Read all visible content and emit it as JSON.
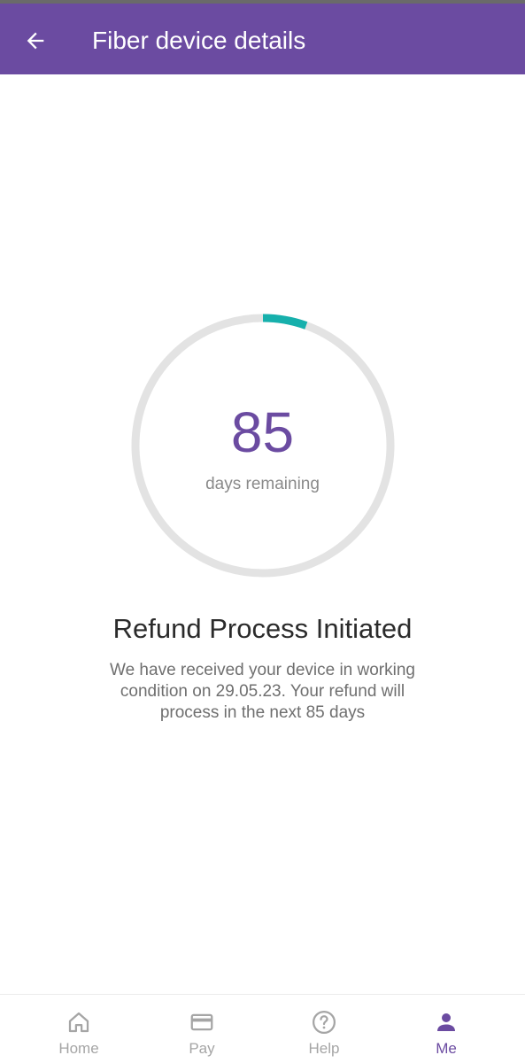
{
  "header": {
    "title": "Fiber device details",
    "back_icon": "arrow-left-icon"
  },
  "countdown": {
    "days": "85",
    "label": "days remaining",
    "progress_fraction": 0.055,
    "track_color": "#e3e3e3",
    "progress_color": "#16b0ac"
  },
  "status": {
    "heading": "Refund Process Initiated",
    "message": "We have received your device in working condition on 29.05.23. Your refund will process in the next 85 days"
  },
  "nav": {
    "items": [
      {
        "label": "Home",
        "icon": "home-icon",
        "active": false
      },
      {
        "label": "Pay",
        "icon": "card-icon",
        "active": false
      },
      {
        "label": "Help",
        "icon": "help-icon",
        "active": false
      },
      {
        "label": "Me",
        "icon": "person-icon",
        "active": true
      }
    ]
  },
  "colors": {
    "brand": "#6b4ba1",
    "inactive": "#a5a5a5"
  }
}
